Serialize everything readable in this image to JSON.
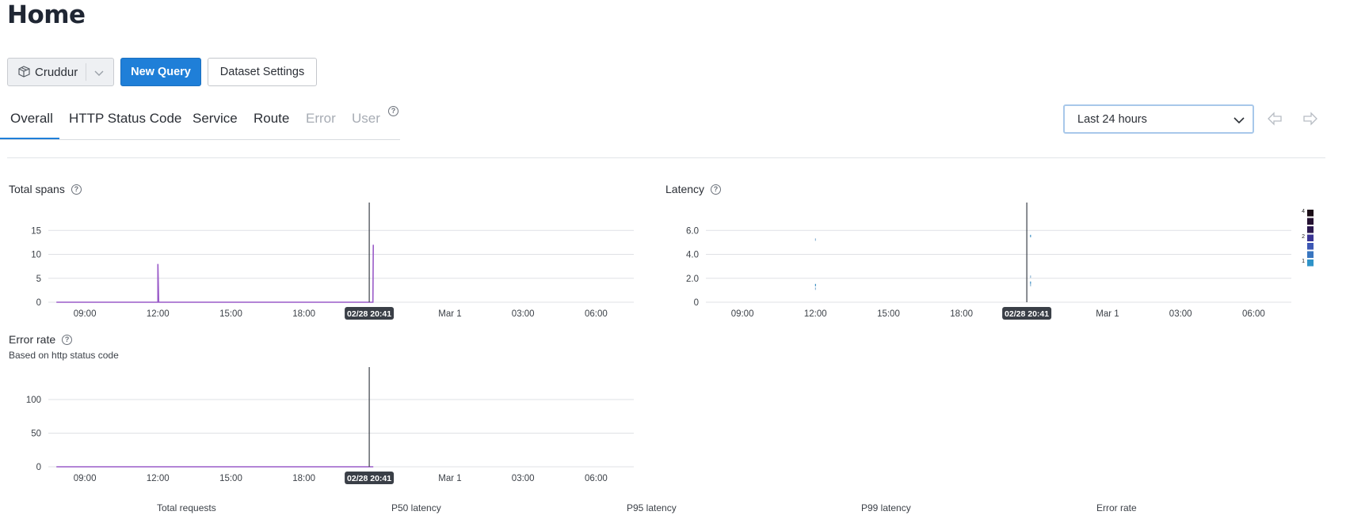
{
  "page": {
    "title": "Home"
  },
  "toolbar": {
    "dataset": "Cruddur",
    "new_query": "New Query",
    "dataset_settings": "Dataset Settings"
  },
  "tabs": [
    {
      "label": "Overall",
      "active": true,
      "disabled": false
    },
    {
      "label": "HTTP Status Code",
      "active": false,
      "disabled": false
    },
    {
      "label": "Service",
      "active": false,
      "disabled": false
    },
    {
      "label": "Route",
      "active": false,
      "disabled": false
    },
    {
      "label": "Error",
      "active": false,
      "disabled": true
    },
    {
      "label": "User",
      "active": false,
      "disabled": true
    }
  ],
  "time_range": {
    "selected": "Last 24 hours"
  },
  "icons": {
    "dataset": "cube-icon",
    "chevron": "chevron-down-icon",
    "help": "question-circle-icon",
    "prev": "arrow-left-icon",
    "next": "arrow-right-icon"
  },
  "colors": {
    "accent": "#1f7fd8",
    "series": "#9a5bc8",
    "marker": "#3a3f47"
  },
  "panels": {
    "total_spans": {
      "title": "Total spans"
    },
    "latency": {
      "title": "Latency"
    },
    "error_rate": {
      "title": "Error rate",
      "subtitle": "Based on http status code"
    }
  },
  "chart_data": [
    {
      "id": "total_spans",
      "type": "line",
      "title": "Total spans",
      "x_ticks": [
        "09:00",
        "12:00",
        "15:00",
        "18:00",
        "Mar 1",
        "03:00",
        "06:00"
      ],
      "y_ticks": [
        "0",
        "5",
        "10",
        "15"
      ],
      "ylim": [
        0,
        20
      ],
      "marker_label": "02/28 20:41",
      "series": [
        {
          "values": [
            {
              "x": "07:50",
              "y": 0
            },
            {
              "x": "12:00",
              "y": 0
            },
            {
              "x": "12:00",
              "y": 8
            },
            {
              "x": "12:02",
              "y": 0
            },
            {
              "x": "20:10",
              "y": 0
            },
            {
              "x": "20:50",
              "y": 0
            },
            {
              "x": "20:51",
              "y": 12
            }
          ]
        }
      ]
    },
    {
      "id": "latency",
      "type": "heatmap",
      "title": "Latency",
      "x_ticks": [
        "09:00",
        "12:00",
        "15:00",
        "18:00",
        "Mar 1",
        "03:00",
        "06:00"
      ],
      "y_ticks": [
        "0",
        "2.0",
        "4.0",
        "6.0"
      ],
      "ylim": [
        0,
        8
      ],
      "marker_label": "02/28 20:41",
      "points": [
        {
          "x": "12:00",
          "y": 5.2
        },
        {
          "x": "12:00",
          "y": 1.4
        },
        {
          "x": "12:00",
          "y": 1.1
        },
        {
          "x": "20:50",
          "y": 5.5
        },
        {
          "x": "20:50",
          "y": 2.1
        },
        {
          "x": "20:50",
          "y": 1.6
        },
        {
          "x": "20:50",
          "y": 1.4
        }
      ],
      "legend": {
        "labels": [
          "4",
          "2",
          "1"
        ],
        "colors": [
          "#1a0d16",
          "#251232",
          "#2c1a4f",
          "#3a3494",
          "#3d58b5",
          "#3976c0",
          "#2f93c8"
        ]
      }
    },
    {
      "id": "error_rate",
      "type": "line",
      "title": "Error rate",
      "subtitle": "Based on http status code",
      "x_ticks": [
        "09:00",
        "12:00",
        "15:00",
        "18:00",
        "Mar 1",
        "03:00",
        "06:00"
      ],
      "y_ticks": [
        "0",
        "50",
        "100"
      ],
      "ylim": [
        0,
        140
      ],
      "marker_label": "02/28 20:41",
      "series": [
        {
          "values": [
            {
              "x": "07:50",
              "y": 0
            },
            {
              "x": "20:51",
              "y": 0
            }
          ]
        }
      ]
    }
  ],
  "summary": {
    "labels": [
      "Total requests",
      "P50 latency",
      "P95 latency",
      "P99 latency",
      "Error rate"
    ]
  }
}
